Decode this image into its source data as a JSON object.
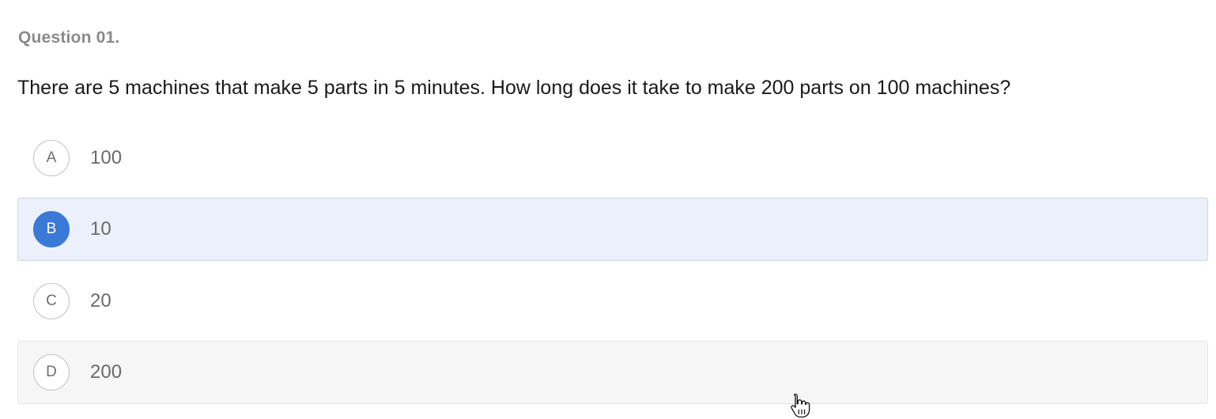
{
  "question": {
    "number_label": "Question 01.",
    "text": "There are 5 machines that make 5 parts in 5 minutes. How long does it take to make 200 parts on 100 machines?"
  },
  "options": [
    {
      "letter": "A",
      "value": "100",
      "state": "default"
    },
    {
      "letter": "B",
      "value": "10",
      "state": "selected"
    },
    {
      "letter": "C",
      "value": "20",
      "state": "default"
    },
    {
      "letter": "D",
      "value": "200",
      "state": "hovered"
    }
  ],
  "colors": {
    "selected_accent": "#3b79d7",
    "selected_background": "#ebf0fb",
    "hover_background": "#f6f6f6"
  },
  "cursor": {
    "icon": "hand-pointer-icon"
  }
}
